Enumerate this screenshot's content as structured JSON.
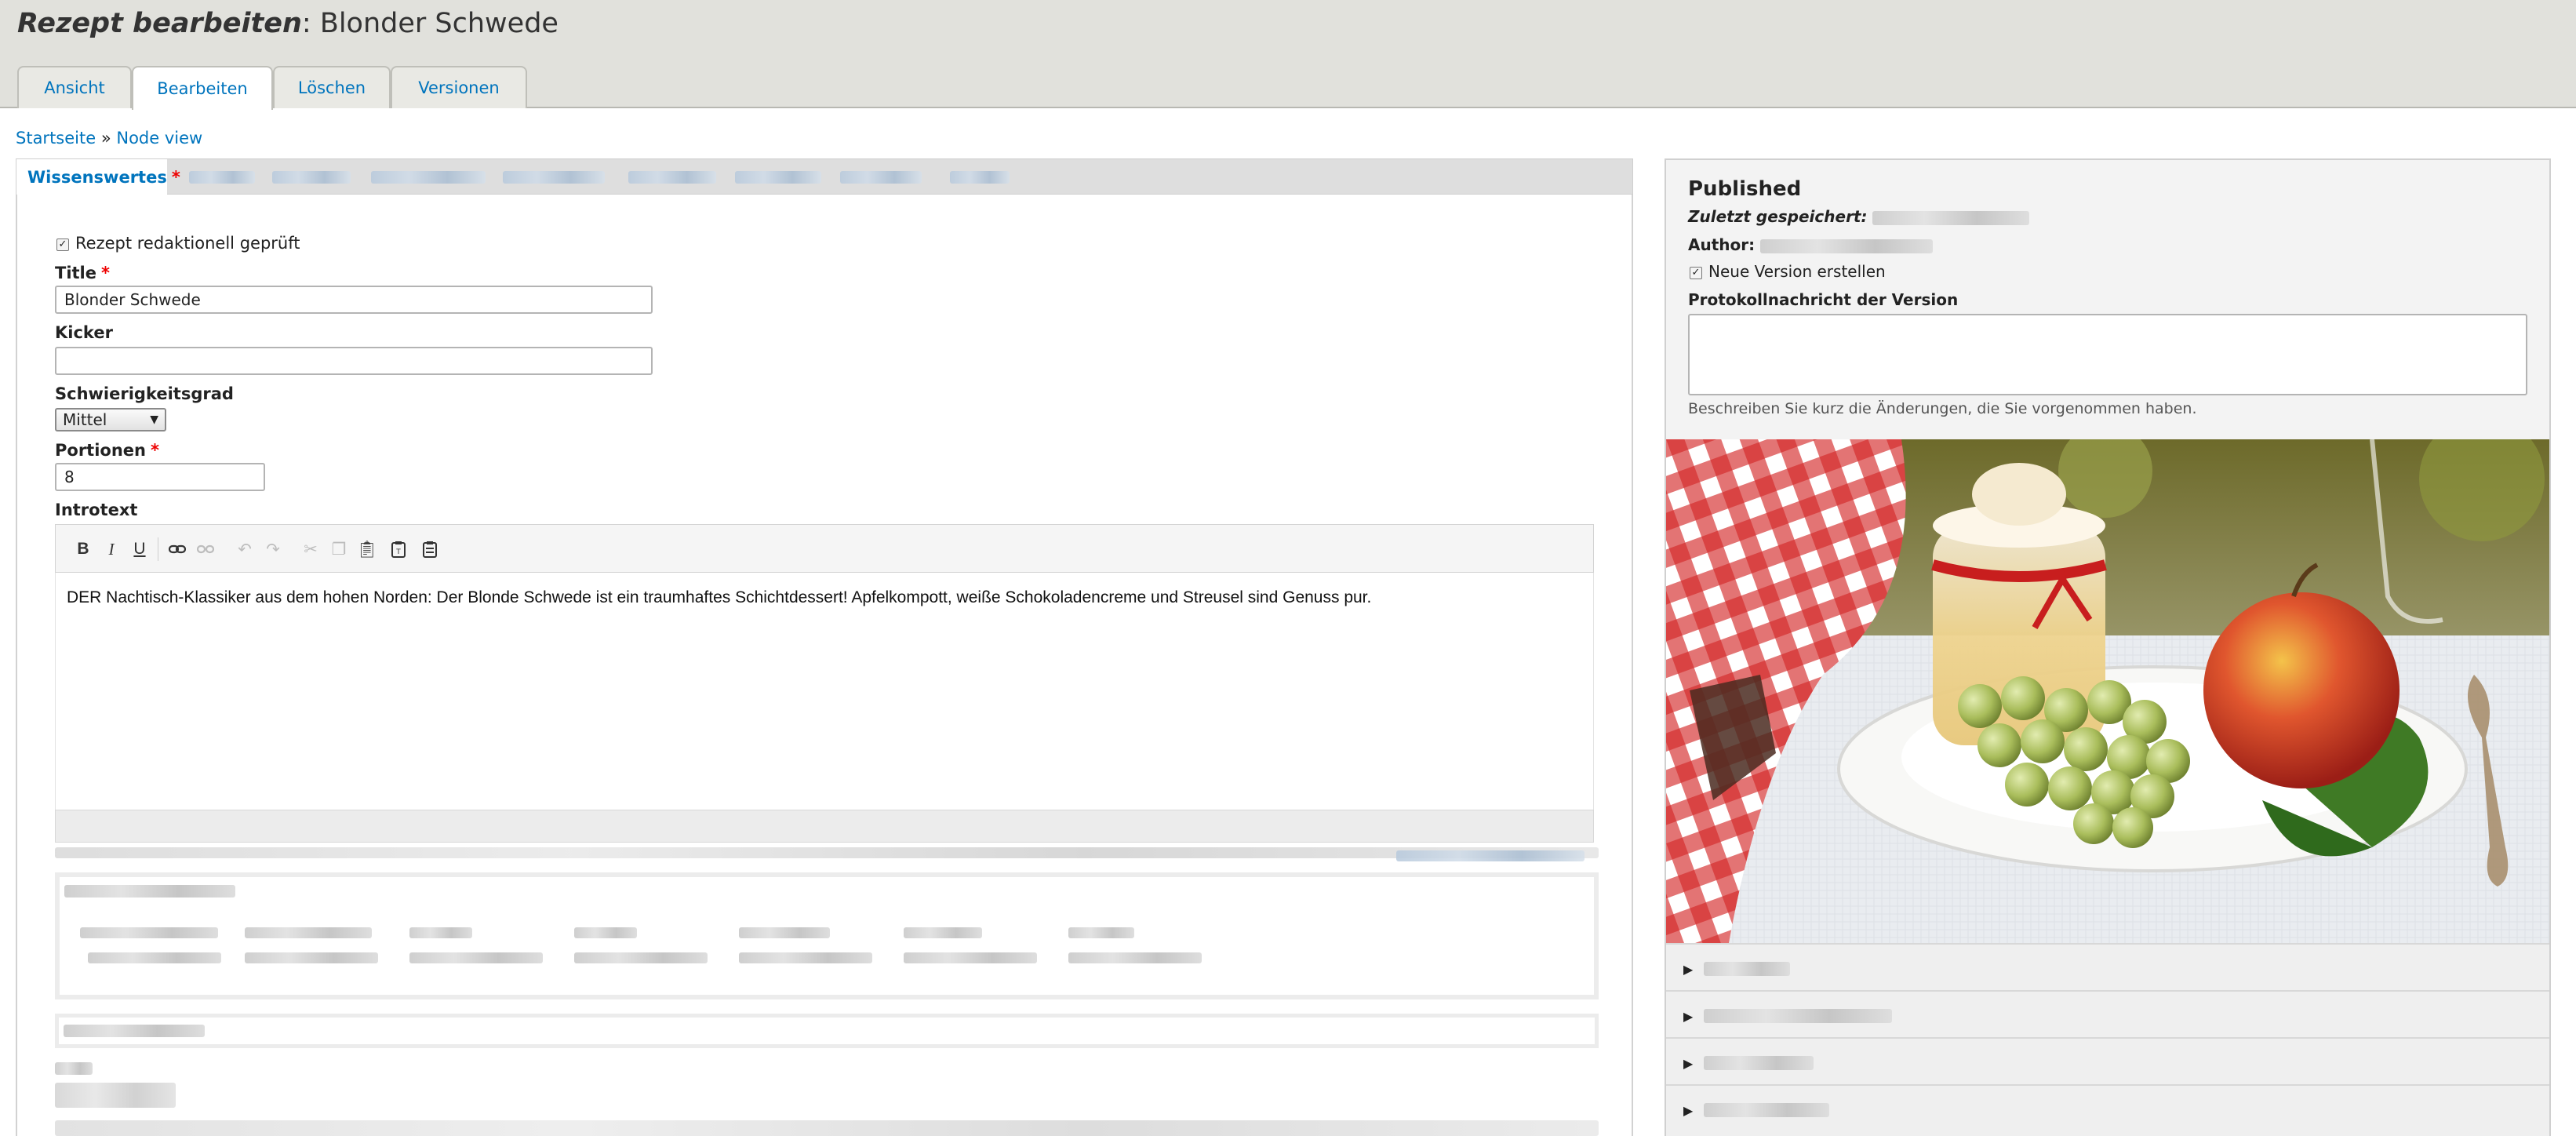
{
  "header": {
    "title_prefix": "Rezept bearbeiten",
    "title_node": "Blonder Schwede",
    "tabs": [
      {
        "label": "Ansicht"
      },
      {
        "label": "Bearbeiten",
        "active": true
      },
      {
        "label": "Löschen"
      },
      {
        "label": "Versionen"
      }
    ]
  },
  "breadcrumb": {
    "home": "Startseite",
    "separator": " » ",
    "current": "Node view"
  },
  "vertical_tabs": {
    "active_label": "Wissenswertes",
    "required_marker": "*"
  },
  "form": {
    "reviewed_checkbox": {
      "label": "Rezept redaktionell geprüft",
      "checked": true
    },
    "title_label": "Title",
    "title_value": "Blonder Schwede",
    "kicker_label": "Kicker",
    "kicker_value": "",
    "difficulty_label": "Schwierigkeitsgrad",
    "difficulty_value": "Mittel",
    "portions_label": "Portionen",
    "portions_value": "8",
    "intro_label": "Introtext",
    "intro_text": "DER Nachtisch-Klassiker aus dem hohen Norden: Der Blonde Schwede ist ein traumhaftes Schichtdessert! Apfelkompott, weiße Schokoladencreme und Streusel sind Genuss pur.",
    "required_marker": "*"
  },
  "editor_toolbar": {
    "bold": "B",
    "italic": "I",
    "underline": "U"
  },
  "sidebar": {
    "status": "Published",
    "last_saved_label": "Zuletzt gespeichert:",
    "author_label": "Author:",
    "new_revision": {
      "label": "Neue Version erstellen",
      "checked": true
    },
    "log_label": "Protokollnachricht der Version",
    "log_value": "",
    "log_description": "Beschreiben Sie kurz die Änderungen, die Sie vorgenommen haben."
  },
  "colors": {
    "link": "#0074bd",
    "header_bg": "#e1e1dc",
    "required": "#e00000"
  }
}
